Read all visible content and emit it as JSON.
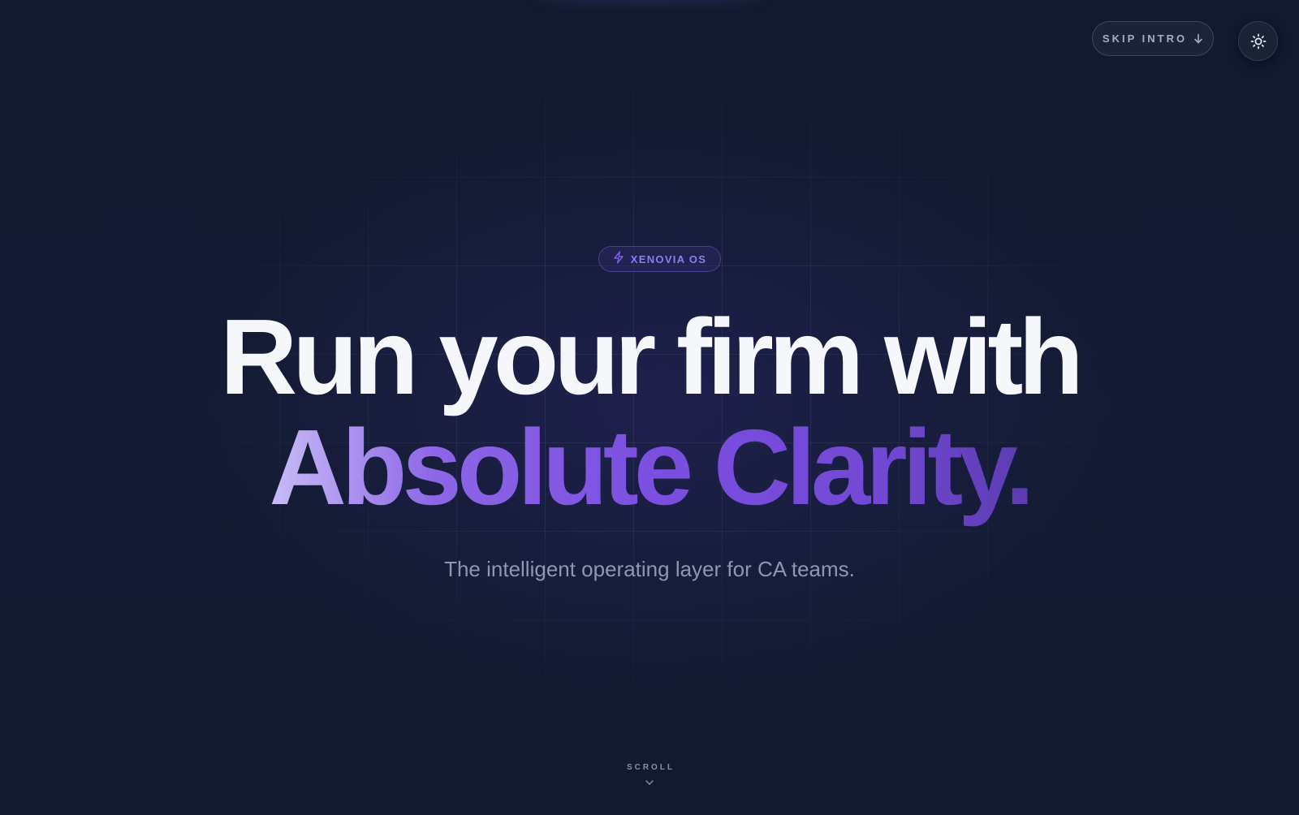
{
  "header": {
    "skip_intro_label": "SKIP INTRO",
    "skip_intro_icon": "arrow-down-icon",
    "theme_toggle_icon": "sun-icon"
  },
  "hero": {
    "badge_label": "XENOVIA OS",
    "badge_icon": "lightning-icon",
    "headline_line1": "Run your firm with",
    "headline_line2": "Absolute Clarity.",
    "subtitle": "The intelligent operating layer for CA teams."
  },
  "scroll": {
    "label": "SCROLL",
    "icon": "chevron-down-icon"
  },
  "colors": {
    "background": "#111a2e",
    "accent": "#7c4fe0",
    "accent_light": "#c9bdf6",
    "headline": "#f6f7fb",
    "muted_text": "#8e96b0"
  }
}
